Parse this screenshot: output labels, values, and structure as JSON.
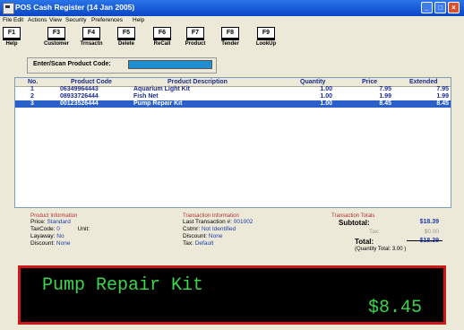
{
  "window": {
    "title": "POS Cash Register   (14 Jan 2005)"
  },
  "menu": [
    "File",
    "Edit",
    "Actions",
    "View",
    "Security",
    "Preferences",
    "Help"
  ],
  "toolbar": [
    {
      "key": "F1",
      "label": "Help"
    },
    {
      "key": "F3",
      "label": "Customer"
    },
    {
      "key": "F4",
      "label": "Trnsactn"
    },
    {
      "key": "F5",
      "label": "Delete"
    },
    {
      "key": "F6",
      "label": "ReCall"
    },
    {
      "key": "F7",
      "label": "Product"
    },
    {
      "key": "F8",
      "label": "Tender"
    },
    {
      "key": "F9",
      "label": "LookUp"
    }
  ],
  "scan": {
    "label": "Enter/Scan Product Code:",
    "value": ""
  },
  "grid": {
    "columns": [
      "No.",
      "Product Code",
      "Product Description",
      "Quantity",
      "Price",
      "Extended"
    ],
    "rows": [
      {
        "no": "1",
        "code": "06349964443",
        "desc": "Aquarium Light Kit",
        "qty": "1.00",
        "price": "7.95",
        "ext": "7.95"
      },
      {
        "no": "2",
        "code": "08933726444",
        "desc": "Fish Net",
        "qty": "1.00",
        "price": "1.99",
        "ext": "1.99"
      },
      {
        "no": "3",
        "code": "00123526444",
        "desc": "Pump Repair Kit",
        "qty": "1.00",
        "price": "8.45",
        "ext": "8.45"
      }
    ],
    "selected_row": 3
  },
  "product_info": {
    "title": "Product Information",
    "price_label": "Price:",
    "price_value": "Standard",
    "taxcode_label": "TaxCode:",
    "taxcode_value": "0",
    "unit_label": "Unit:",
    "unit_value": "",
    "layaway_label": "Layaway:",
    "layaway_value": "No",
    "discount_label": "Discount:",
    "discount_value": "None"
  },
  "transaction_info": {
    "title": "Transaction Information",
    "last_label": "Last Transaction #:",
    "last_value": "001002",
    "cstmr_label": "Cstmr:",
    "cstmr_value": "Not Identified",
    "discount_label": "Discount:",
    "discount_value": "None",
    "tax_label": "Tax:",
    "tax_value": "Default"
  },
  "totals": {
    "title": "Transaction Totals",
    "subtotal_label": "Subtotal:",
    "subtotal_value": "$18.39",
    "tax_label": "Tax:",
    "tax_value": "$0.00",
    "total_label": "Total:",
    "total_value": "$18.39",
    "qty_note": "(Quantity Total: 3.00 )"
  },
  "display": {
    "product": "Pump Repair Kit",
    "price": "$8.45"
  },
  "colors": {
    "display_text": "#3bd64b",
    "display_border": "#ce1818",
    "selection": "#2b5fc9"
  }
}
